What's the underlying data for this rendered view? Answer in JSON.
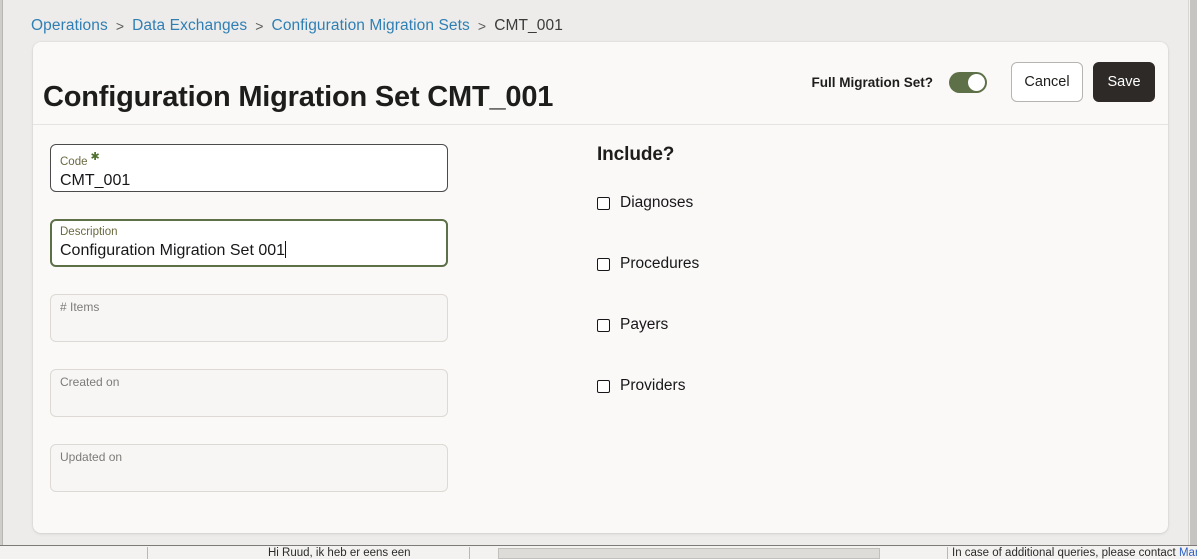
{
  "breadcrumb": {
    "separator": ">",
    "items": [
      {
        "label": "Operations",
        "link": true
      },
      {
        "label": "Data Exchanges",
        "link": true
      },
      {
        "label": "Configuration Migration Sets",
        "link": true
      },
      {
        "label": "CMT_001",
        "link": false
      }
    ]
  },
  "header": {
    "title": "Configuration Migration Set CMT_001",
    "toggle_label": "Full Migration Set?",
    "toggle_on": true,
    "cancel_label": "Cancel",
    "save_label": "Save"
  },
  "form": {
    "fields": [
      {
        "name": "code",
        "label": "Code",
        "required": true,
        "value": "CMT_001",
        "disabled": false,
        "focused": false
      },
      {
        "name": "description",
        "label": "Description",
        "required": false,
        "value": "Configuration Migration Set 001",
        "disabled": false,
        "focused": true
      },
      {
        "name": "num-items",
        "label": "# Items",
        "required": false,
        "value": "",
        "disabled": true,
        "focused": false
      },
      {
        "name": "created-on",
        "label": "Created on",
        "required": false,
        "value": "",
        "disabled": true,
        "focused": false
      },
      {
        "name": "updated-on",
        "label": "Updated on",
        "required": false,
        "value": "",
        "disabled": true,
        "focused": false
      }
    ]
  },
  "include": {
    "title": "Include?",
    "options": [
      {
        "name": "diagnoses",
        "label": "Diagnoses",
        "checked": false
      },
      {
        "name": "procedures",
        "label": "Procedures",
        "checked": false
      },
      {
        "name": "payers",
        "label": "Payers",
        "checked": false
      },
      {
        "name": "providers",
        "label": "Providers",
        "checked": false
      }
    ]
  },
  "background_window": {
    "left_text": "Hi Ruud, ik heb er eens een",
    "right_text": "In case of additional queries, please contact",
    "right_link": "Marco Verkerk"
  },
  "colors": {
    "page_background": "#edecea",
    "card_background": "#faf9f7",
    "accent_green": "#5d7048",
    "link_blue": "#2f7fb5",
    "save_dark": "#2e2a28",
    "label_olive": "#6b6a42"
  }
}
